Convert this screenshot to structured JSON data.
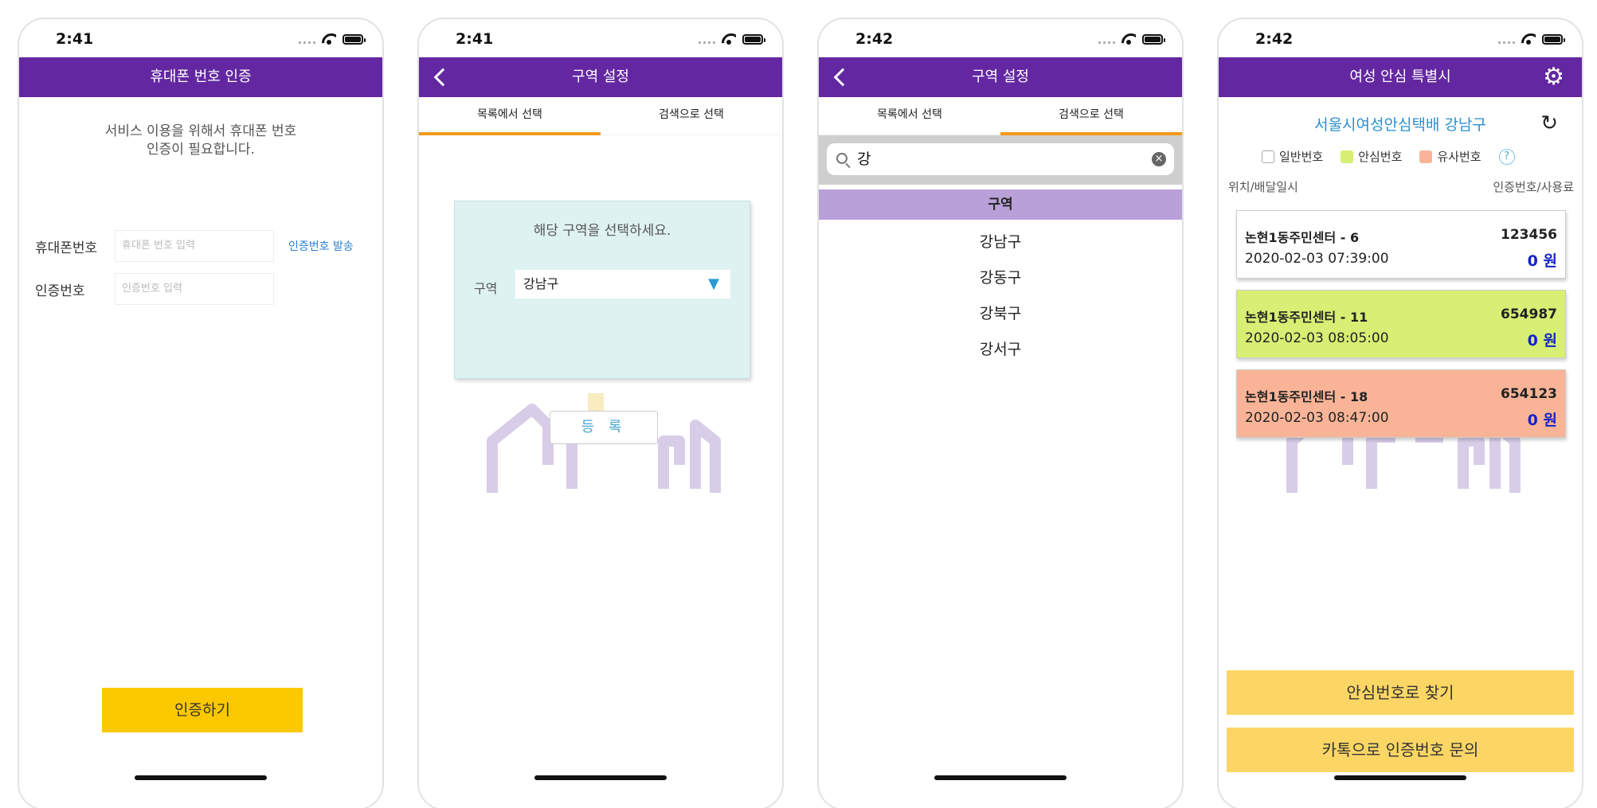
{
  "screens": [
    {
      "status_time": "2:41",
      "title": "휴대폰 번호 인증",
      "message_line1": "서비스 이용을 위해서 휴대폰 번호",
      "message_line2": "인증이 필요합니다.",
      "phone_label": "휴대폰번호",
      "phone_placeholder": "휴대폰 번호 입력",
      "send_code_link": "인증번호 발송",
      "code_label": "인증번호",
      "code_placeholder": "인증번호 입력",
      "verify_button": "인증하기"
    },
    {
      "status_time": "2:41",
      "title": "구역 설정",
      "tabs": [
        "목록에서 선택",
        "검색으로 선택"
      ],
      "active_tab": 0,
      "dialog_message": "해당 구역을 선택하세요.",
      "district_label": "구역",
      "district_value": "강남구",
      "register_button": "등 록"
    },
    {
      "status_time": "2:42",
      "title": "구역 설정",
      "tabs": [
        "목록에서 선택",
        "검색으로 선택"
      ],
      "active_tab": 1,
      "search_value": "강",
      "list_header": "구역",
      "results": [
        "강남구",
        "강동구",
        "강북구",
        "강서구"
      ]
    },
    {
      "status_time": "2:42",
      "title": "여성 안심 특별시",
      "subtitle": "서울시여성안심택배 강남구",
      "legend": [
        {
          "label": "일반번호",
          "color": "#ffffff"
        },
        {
          "label": "안심번호",
          "color": "#d6ef74"
        },
        {
          "label": "유사번호",
          "color": "#f9b497"
        }
      ],
      "help": "?",
      "col_left": "위치/배달일시",
      "col_right": "인증번호/사용료",
      "cards": [
        {
          "location": "논현1동주민센터 - 6",
          "code": "123456",
          "datetime": "2020-02-03 07:39:00",
          "fee": "0 원",
          "color": "#ffffff"
        },
        {
          "location": "논현1동주민센터 - 11",
          "code": "654987",
          "datetime": "2020-02-03 08:05:00",
          "fee": "0 원",
          "color": "#d6ef74"
        },
        {
          "location": "논현1동주민센터 - 18",
          "code": "654123",
          "datetime": "2020-02-03 08:47:00",
          "fee": "0 원",
          "color": "#f9b497"
        }
      ],
      "find_button": "안심번호로 찾기",
      "kakao_button": "카톡으로 인증번호 문의"
    }
  ],
  "colors": {
    "nav": "#6328a1",
    "accent_orange": "#f19a1d",
    "yellow": "#fcc800",
    "link": "#2a7fd4"
  }
}
